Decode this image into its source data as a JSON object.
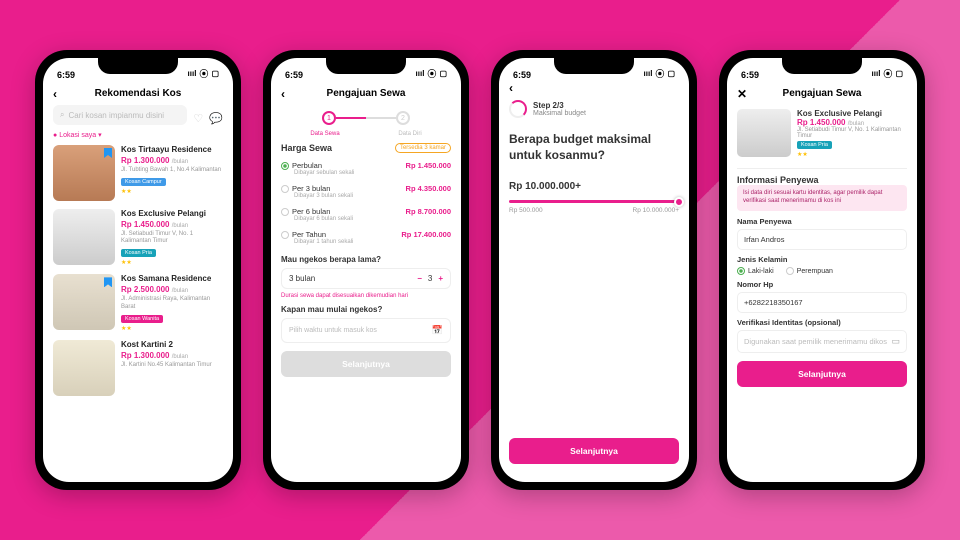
{
  "statusbar": {
    "time": "6:59",
    "signal": "ıııl",
    "wifi": "⦿",
    "batt": "▢"
  },
  "p1": {
    "title": "Rekomendasi Kos",
    "search_ph": "Cari kosan impianmu disini",
    "loc": "Lokasi saya  ▾",
    "cards": [
      {
        "name": "Kos Tirtaayu Residence",
        "price": "Rp 1.300.000",
        "per": "/bulan",
        "addr": "Jl. Tubting Bawah 1, No.4 Kalimantan",
        "badge": "Kosan Campur",
        "bcls": "b-campur",
        "stars": "★★",
        "bm": true
      },
      {
        "name": "Kos Exclusive Pelangi",
        "price": "Rp 1.450.000",
        "per": "/bulan",
        "addr": "Jl. Setiabudi Timur V, No. 1 Kalimantan Timur",
        "badge": "Kosan Pria",
        "bcls": "b-pria",
        "stars": "★★",
        "bm": false
      },
      {
        "name": "Kos Samana Residence",
        "price": "Rp 2.500.000",
        "per": "/bulan",
        "addr": "Jl. Administrasi Raya, Kalimantan Barat",
        "badge": "Kosan Wanita",
        "bcls": "b-wanita",
        "stars": "★★",
        "bm": true
      },
      {
        "name": "Kost Kartini 2",
        "price": "Rp 1.300.000",
        "per": "/bulan",
        "addr": "Jl. Kartini No.45 Kalimantan Timur",
        "badge": "",
        "bcls": "",
        "stars": "",
        "bm": false
      }
    ]
  },
  "p2": {
    "title": "Pengajuan Sewa",
    "step1": "Data Sewa",
    "step2": "Data Diri",
    "harga_title": "Harga Sewa",
    "pill": "Tersedia 3 kamar",
    "rows": [
      {
        "lbl": "Perbulan",
        "sub": "Dibayar sebulan sekali",
        "val": "Rp 1.450.000",
        "on": true
      },
      {
        "lbl": "Per 3 bulan",
        "sub": "Dibayar 3 bulan sekali",
        "val": "Rp 4.350.000",
        "on": false
      },
      {
        "lbl": "Per 6 bulan",
        "sub": "Dibayar 6 bulan sekali",
        "val": "Rp 8.700.000",
        "on": false
      },
      {
        "lbl": "Per Tahun",
        "sub": "Dibayar 1 tahun sekali",
        "val": "Rp 17.400.000",
        "on": false
      }
    ],
    "q1": "Mau ngekos berapa lama?",
    "qty_label": "3 bulan",
    "qty_val": "3",
    "note": "Durasi sewa dapat disesuaikan dikemudian hari",
    "q2": "Kapan mau mulai ngekos?",
    "date_ph": "Pilih waktu untuk masuk kos",
    "btn": "Selanjutnya"
  },
  "p3": {
    "step": "Step 2/3",
    "step_sub": "Maksimal budget",
    "q": "Berapa budget maksimal untuk kosanmu?",
    "value": "Rp 10.000.000+",
    "min": "Rp 500.000",
    "max": "Rp 10.000.000+",
    "btn": "Selanjutnya"
  },
  "p4": {
    "title": "Pengajuan Sewa",
    "prop": {
      "name": "Kos Exclusive Pelangi",
      "price": "Rp 1.450.000",
      "per": "/bulan",
      "addr": "Jl. Setiabudi Timur V, No. 1 Kalimantan Timur",
      "badge": "Kosan Pria",
      "stars": "★★"
    },
    "sec": "Informasi Penyewa",
    "info": "Isi data diri sesuai kartu identitas, agar pemilik dapat verifikasi saat menerimamu di kos ini",
    "f_name_lbl": "Nama Penyewa",
    "f_name_val": "Irfan Andros",
    "f_gender_lbl": "Jenis Kelamin",
    "g1": "Laki-laki",
    "g2": "Perempuan",
    "f_phone_lbl": "Nomor Hp",
    "f_phone_val": "+6282218350167",
    "f_id_lbl": "Verifikasi Identitas (opsional)",
    "f_id_ph": "Digunakan saat pemilik menerimamu dikos",
    "btn": "Selanjutnya"
  }
}
